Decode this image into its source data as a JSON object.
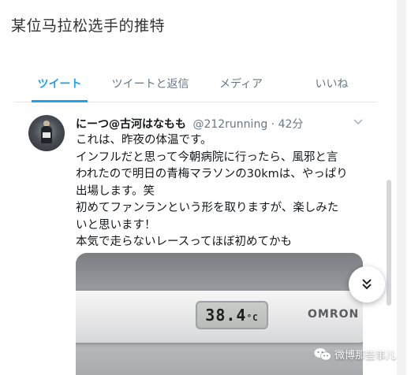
{
  "article": {
    "title": "某位马拉松选手的推特"
  },
  "tabs": [
    {
      "label": "ツイート",
      "active": true
    },
    {
      "label": "ツイートと返信",
      "active": false
    },
    {
      "label": "メディア",
      "active": false
    },
    {
      "label": "いいね",
      "active": false
    }
  ],
  "tweet": {
    "display_name": "にーつ@古河はなもも",
    "handle": "@212running",
    "separator": "·",
    "time": "42分",
    "lines": [
      "これは、昨夜の体温です。",
      "インフルだと思って今朝病院に行ったら、風邪と言",
      "われたので明日の青梅マラソンの30kmは、やっぱり",
      "出場します。笑",
      "初めてファンランという形を取りますが、楽しみた",
      "いと思います！",
      "本気で走らないレースってほぼ初めてかも"
    ],
    "media": {
      "thermometer_reading": "38.4",
      "thermometer_unit": "°C",
      "brand": "OMRON"
    }
  },
  "watermark": {
    "text": "微博那些事儿"
  },
  "colors": {
    "accent": "#1da1f2",
    "muted": "#657786"
  },
  "icons": {
    "caret": "chevron-down-icon",
    "fab": "double-chevron-down-icon",
    "watermark": "wechat-icon"
  }
}
